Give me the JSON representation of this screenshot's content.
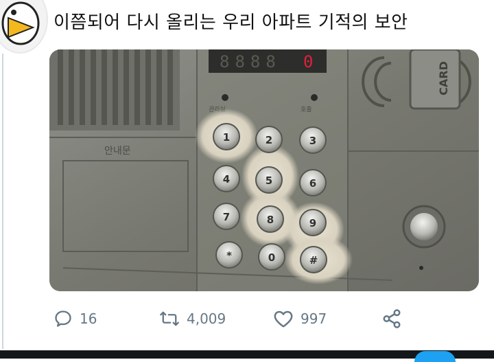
{
  "tweet": {
    "header_clip": "",
    "text": "이쯤되어 다시 올리는 우리 아파트 기적의 보안"
  },
  "photo": {
    "display": "8.8.8.0",
    "labels": {
      "notice": "안내문",
      "card": "CARD",
      "left_small": "관리실",
      "right_small": "호출"
    },
    "keys": [
      "1",
      "2",
      "3",
      "4",
      "5",
      "6",
      "7",
      "8",
      "9",
      "*",
      "0",
      "#"
    ]
  },
  "actions": {
    "reply": {
      "icon": "reply-icon",
      "count": "16"
    },
    "retweet": {
      "icon": "retweet-icon",
      "count": "4,009"
    },
    "like": {
      "icon": "heart-icon",
      "count": "997"
    },
    "share": {
      "icon": "share-icon"
    }
  },
  "colors": {
    "icon_gray": "#657786",
    "display_red": "#e0203a",
    "twitter_blue": "#1da1f2"
  }
}
